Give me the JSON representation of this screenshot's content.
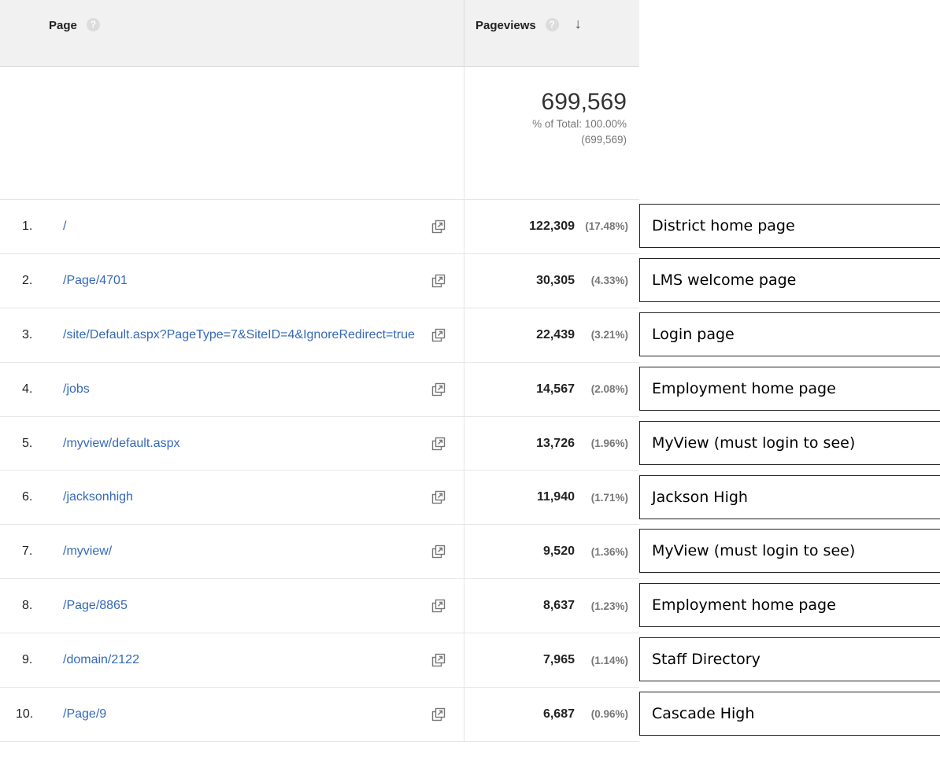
{
  "header": {
    "page_label": "Page",
    "pageviews_label": "Pageviews",
    "help_glyph": "?",
    "sort_glyph": "↓"
  },
  "totals": {
    "value": "699,569",
    "pct_line": "% of Total: 100.00%",
    "pct_total": "(699,569)"
  },
  "rows": [
    {
      "rank": "1.",
      "page": "/",
      "pageviews": "122,309",
      "pct": "(17.48%)",
      "annotation": "District home page"
    },
    {
      "rank": "2.",
      "page": "/Page/4701",
      "pageviews": "30,305",
      "pct": "(4.33%)",
      "annotation": "LMS welcome page"
    },
    {
      "rank": "3.",
      "page": "/site/Default.aspx?PageType=7&SiteID=4&IgnoreRedirect=true",
      "pageviews": "22,439",
      "pct": "(3.21%)",
      "annotation": "Login page"
    },
    {
      "rank": "4.",
      "page": "/jobs",
      "pageviews": "14,567",
      "pct": "(2.08%)",
      "annotation": "Employment home page"
    },
    {
      "rank": "5.",
      "page": "/myview/default.aspx",
      "pageviews": "13,726",
      "pct": "(1.96%)",
      "annotation": "MyView (must login to see)"
    },
    {
      "rank": "6.",
      "page": "/jacksonhigh",
      "pageviews": "11,940",
      "pct": "(1.71%)",
      "annotation": "Jackson High"
    },
    {
      "rank": "7.",
      "page": "/myview/",
      "pageviews": "9,520",
      "pct": "(1.36%)",
      "annotation": "MyView (must login to see)"
    },
    {
      "rank": "8.",
      "page": "/Page/8865",
      "pageviews": "8,637",
      "pct": "(1.23%)",
      "annotation": "Employment home page"
    },
    {
      "rank": "9.",
      "page": "/domain/2122",
      "pageviews": "7,965",
      "pct": "(1.14%)",
      "annotation": "Staff Directory"
    },
    {
      "rank": "10.",
      "page": "/Page/9",
      "pageviews": "6,687",
      "pct": "(0.96%)",
      "annotation": "Cascade High"
    }
  ]
}
